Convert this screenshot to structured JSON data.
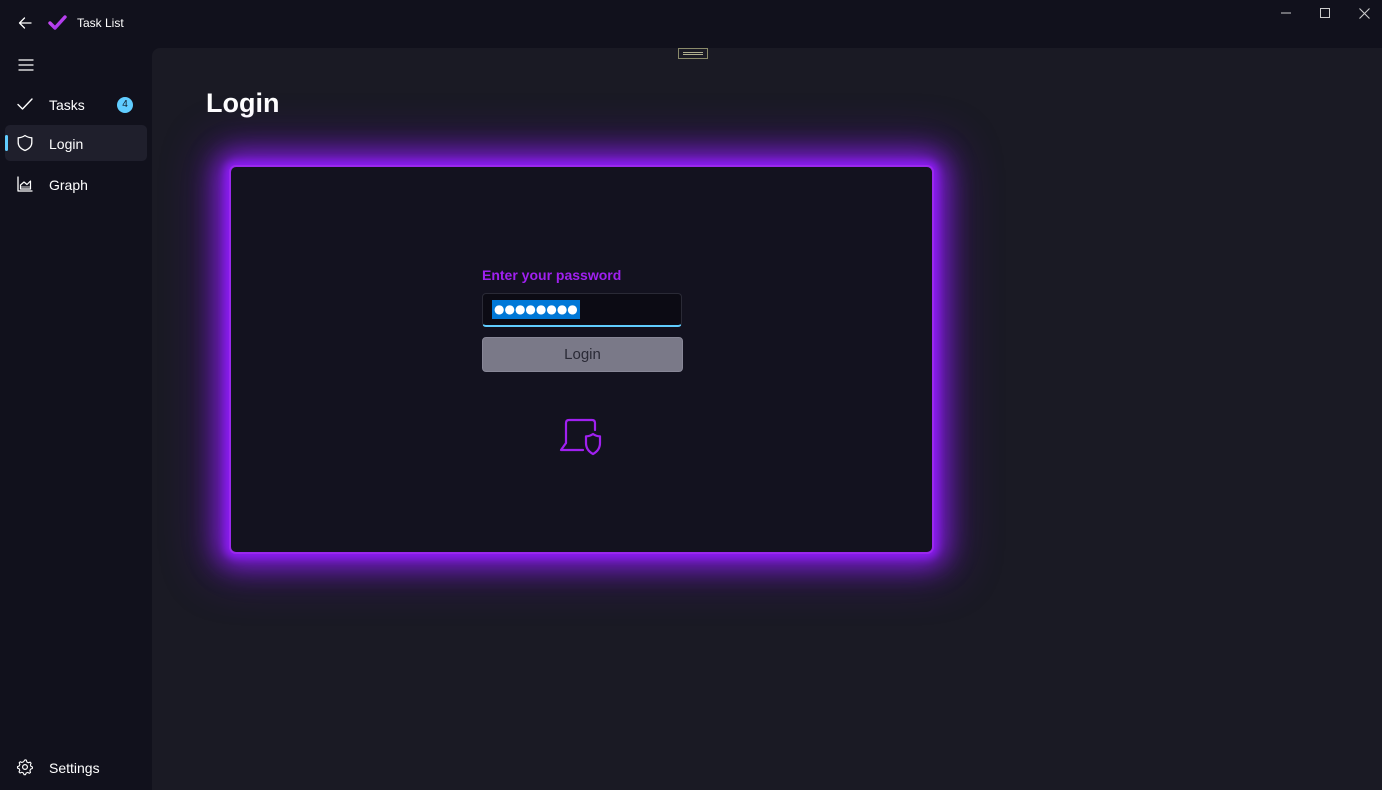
{
  "window": {
    "title": "Task List",
    "accent_color": "#60cdff",
    "glow_color": "#a020f0"
  },
  "sidebar": {
    "items": [
      {
        "label": "Tasks",
        "icon": "checkmark-icon",
        "badge": "4"
      },
      {
        "label": "Login",
        "icon": "shield-icon",
        "selected": true
      },
      {
        "label": "Graph",
        "icon": "area-chart-icon"
      }
    ],
    "footer": {
      "label": "Settings",
      "icon": "gear-icon"
    }
  },
  "page": {
    "title": "Login"
  },
  "login": {
    "prompt": "Enter your password",
    "password_value": "●●●●●●●●",
    "button_label": "Login",
    "icon": "laptop-shield-icon"
  }
}
